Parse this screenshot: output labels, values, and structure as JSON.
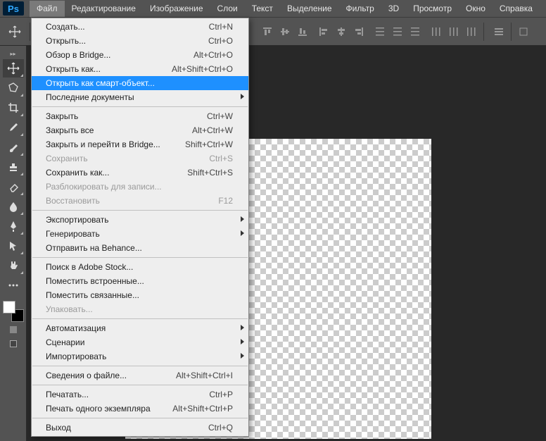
{
  "app": {
    "logo": "Ps"
  },
  "menubar": [
    "Файл",
    "Редактирование",
    "Изображение",
    "Слои",
    "Текст",
    "Выделение",
    "Фильтр",
    "3D",
    "Просмотр",
    "Окно",
    "Справка"
  ],
  "file_menu": {
    "groups": [
      [
        {
          "label": "Создать...",
          "shortcut": "Ctrl+N",
          "disabled": false,
          "submenu": false
        },
        {
          "label": "Открыть...",
          "shortcut": "Ctrl+O",
          "disabled": false,
          "submenu": false
        },
        {
          "label": "Обзор в Bridge...",
          "shortcut": "Alt+Ctrl+O",
          "disabled": false,
          "submenu": false
        },
        {
          "label": "Открыть как...",
          "shortcut": "Alt+Shift+Ctrl+O",
          "disabled": false,
          "submenu": false
        },
        {
          "label": "Открыть как смарт-объект...",
          "shortcut": "",
          "disabled": false,
          "submenu": false,
          "highlight": true
        },
        {
          "label": "Последние документы",
          "shortcut": "",
          "disabled": false,
          "submenu": true
        }
      ],
      [
        {
          "label": "Закрыть",
          "shortcut": "Ctrl+W",
          "disabled": false,
          "submenu": false
        },
        {
          "label": "Закрыть все",
          "shortcut": "Alt+Ctrl+W",
          "disabled": false,
          "submenu": false
        },
        {
          "label": "Закрыть и перейти в Bridge...",
          "shortcut": "Shift+Ctrl+W",
          "disabled": false,
          "submenu": false
        },
        {
          "label": "Сохранить",
          "shortcut": "Ctrl+S",
          "disabled": true,
          "submenu": false
        },
        {
          "label": "Сохранить как...",
          "shortcut": "Shift+Ctrl+S",
          "disabled": false,
          "submenu": false
        },
        {
          "label": "Разблокировать для записи...",
          "shortcut": "",
          "disabled": true,
          "submenu": false
        },
        {
          "label": "Восстановить",
          "shortcut": "F12",
          "disabled": true,
          "submenu": false
        }
      ],
      [
        {
          "label": "Экспортировать",
          "shortcut": "",
          "disabled": false,
          "submenu": true
        },
        {
          "label": "Генерировать",
          "shortcut": "",
          "disabled": false,
          "submenu": true
        },
        {
          "label": "Отправить на Behance...",
          "shortcut": "",
          "disabled": false,
          "submenu": false
        }
      ],
      [
        {
          "label": "Поиск в Adobe Stock...",
          "shortcut": "",
          "disabled": false,
          "submenu": false
        },
        {
          "label": "Поместить встроенные...",
          "shortcut": "",
          "disabled": false,
          "submenu": false
        },
        {
          "label": "Поместить связанные...",
          "shortcut": "",
          "disabled": false,
          "submenu": false
        },
        {
          "label": "Упаковать...",
          "shortcut": "",
          "disabled": true,
          "submenu": false
        }
      ],
      [
        {
          "label": "Автоматизация",
          "shortcut": "",
          "disabled": false,
          "submenu": true
        },
        {
          "label": "Сценарии",
          "shortcut": "",
          "disabled": false,
          "submenu": true
        },
        {
          "label": "Импортировать",
          "shortcut": "",
          "disabled": false,
          "submenu": true
        }
      ],
      [
        {
          "label": "Сведения о файле...",
          "shortcut": "Alt+Shift+Ctrl+I",
          "disabled": false,
          "submenu": false
        }
      ],
      [
        {
          "label": "Печатать...",
          "shortcut": "Ctrl+P",
          "disabled": false,
          "submenu": false
        },
        {
          "label": "Печать одного экземпляра",
          "shortcut": "Alt+Shift+Ctrl+P",
          "disabled": false,
          "submenu": false
        }
      ],
      [
        {
          "label": "Выход",
          "shortcut": "Ctrl+Q",
          "disabled": false,
          "submenu": false
        }
      ]
    ]
  },
  "tools": [
    "move-tool",
    "lasso-tool",
    "crop-tool",
    "eyedropper-tool",
    "brush-tool",
    "stamp-tool",
    "eraser-tool",
    "blur-tool",
    "pen-tool",
    "path-select-tool",
    "hand-tool",
    "zoom-tool"
  ]
}
